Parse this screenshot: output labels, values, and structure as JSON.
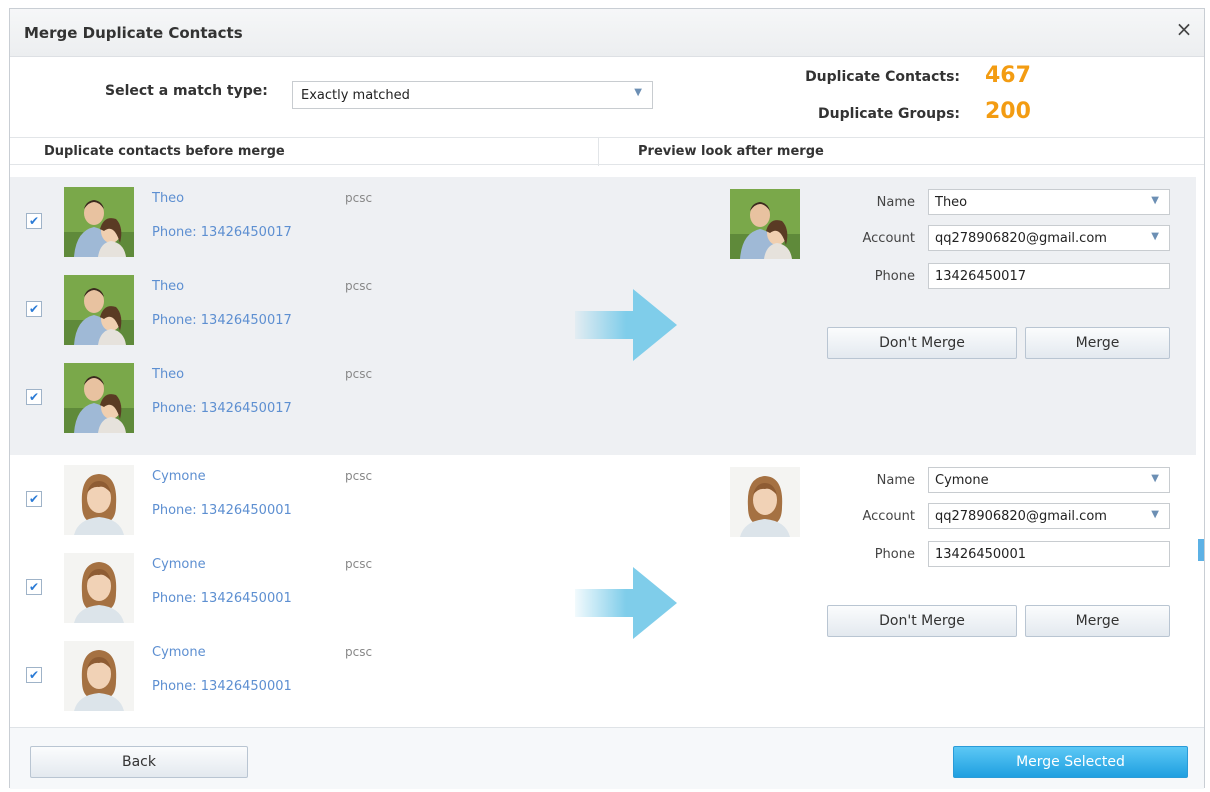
{
  "dialog": {
    "title": "Merge Duplicate Contacts",
    "close_icon": "×"
  },
  "match": {
    "label": "Select a match type:",
    "selected": "Exactly matched"
  },
  "stats": {
    "contacts_label": "Duplicate Contacts:",
    "contacts_value": "467",
    "groups_label": "Duplicate Groups:",
    "groups_value": "200"
  },
  "columns": {
    "left": "Duplicate contacts before merge",
    "right": "Preview look after merge"
  },
  "groups": [
    {
      "entries": [
        {
          "name": "Theo",
          "phone": "Phone: 13426450017",
          "source": "pcsc",
          "checked": true
        },
        {
          "name": "Theo",
          "phone": "Phone: 13426450017",
          "source": "pcsc",
          "checked": true
        },
        {
          "name": "Theo",
          "phone": "Phone: 13426450017",
          "source": "pcsc",
          "checked": true
        }
      ],
      "preview": {
        "name_label": "Name",
        "name": "Theo",
        "account_label": "Account",
        "account": "qq278906820@gmail.com",
        "phone_label": "Phone",
        "phone": "13426450017"
      }
    },
    {
      "entries": [
        {
          "name": "Cymone",
          "phone": "Phone: 13426450001",
          "source": "pcsc",
          "checked": true
        },
        {
          "name": "Cymone",
          "phone": "Phone: 13426450001",
          "source": "pcsc",
          "checked": true
        },
        {
          "name": "Cymone",
          "phone": "Phone: 13426450001",
          "source": "pcsc",
          "checked": true
        }
      ],
      "preview": {
        "name_label": "Name",
        "name": "Cymone",
        "account_label": "Account",
        "account": "qq278906820@gmail.com",
        "phone_label": "Phone",
        "phone": "13426450001"
      }
    }
  ],
  "buttons": {
    "dont_merge": "Don't Merge",
    "merge": "Merge",
    "back": "Back",
    "merge_selected": "Merge Selected"
  },
  "icons": {
    "checkbox": "checkmark-icon",
    "arrow": "arrow-right-icon",
    "dropdown": "chevron-down-icon"
  },
  "colors": {
    "stat_value": "#f39c12",
    "link": "#5d8fd1",
    "primary_button": "#1f9fe0",
    "arrow": "#7fcdea"
  }
}
